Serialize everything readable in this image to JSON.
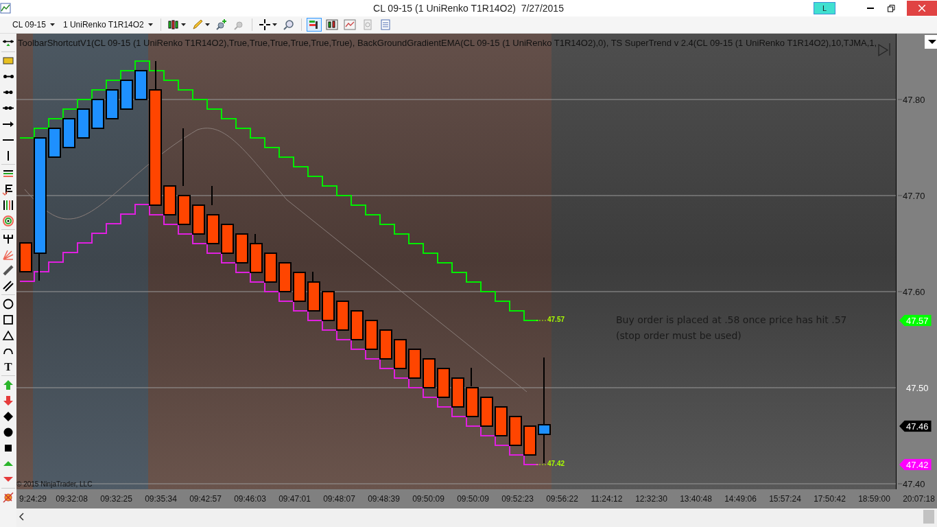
{
  "window": {
    "title": "CL 09-15 (1 UniRenko T1R14O2)  7/27/2015",
    "badge": "L"
  },
  "toolbar": {
    "instrument": "CL 09-15",
    "bar_type": "1 UniRenko T1R14O2"
  },
  "drawing_tools": {
    "text_tool": "T"
  },
  "chart": {
    "indicators_label": "ToolbarShortcutV1(CL 09-15 (1 UniRenko T1R14O2),True,True,True,True,True,True),  BackGroundGradientEMA(CL 09-15 (1 UniRenko T1R14O2),0),  TS SuperTrend v 2.4(CL 09-15 (1 UniRenko T1R14O2),10,TJMA,1,",
    "copyright": "© 2015 NinjaTrader, LLC",
    "annotation": "Buy order is placed at .58 once price has hit .57 (stop order must be used)",
    "line_labels": [
      {
        "text": "47.57"
      },
      {
        "text": "47.42"
      }
    ],
    "price_ticks": [
      "47.80",
      "47.70",
      "47.60",
      "47.40"
    ],
    "price_markers": [
      {
        "text": "47.57",
        "color": "#00ff00"
      },
      {
        "text": "47.50",
        "color": "#808080"
      },
      {
        "text": "47.46",
        "color": "#000000"
      },
      {
        "text": "47.42",
        "color": "#ff00ff"
      }
    ],
    "time_ticks": [
      "9:24:29",
      "09:32:08",
      "09:32:25",
      "09:35:34",
      "09:42:57",
      "09:46:03",
      "09:47:01",
      "09:48:07",
      "09:48:39",
      "09:50:09",
      "09:50:09",
      "09:52:23",
      "09:56:22",
      "11:24:12",
      "12:32:30",
      "13:40:48",
      "14:49:06",
      "15:57:24",
      "17:50:42",
      "18:59:00",
      "20:07:18"
    ]
  }
}
